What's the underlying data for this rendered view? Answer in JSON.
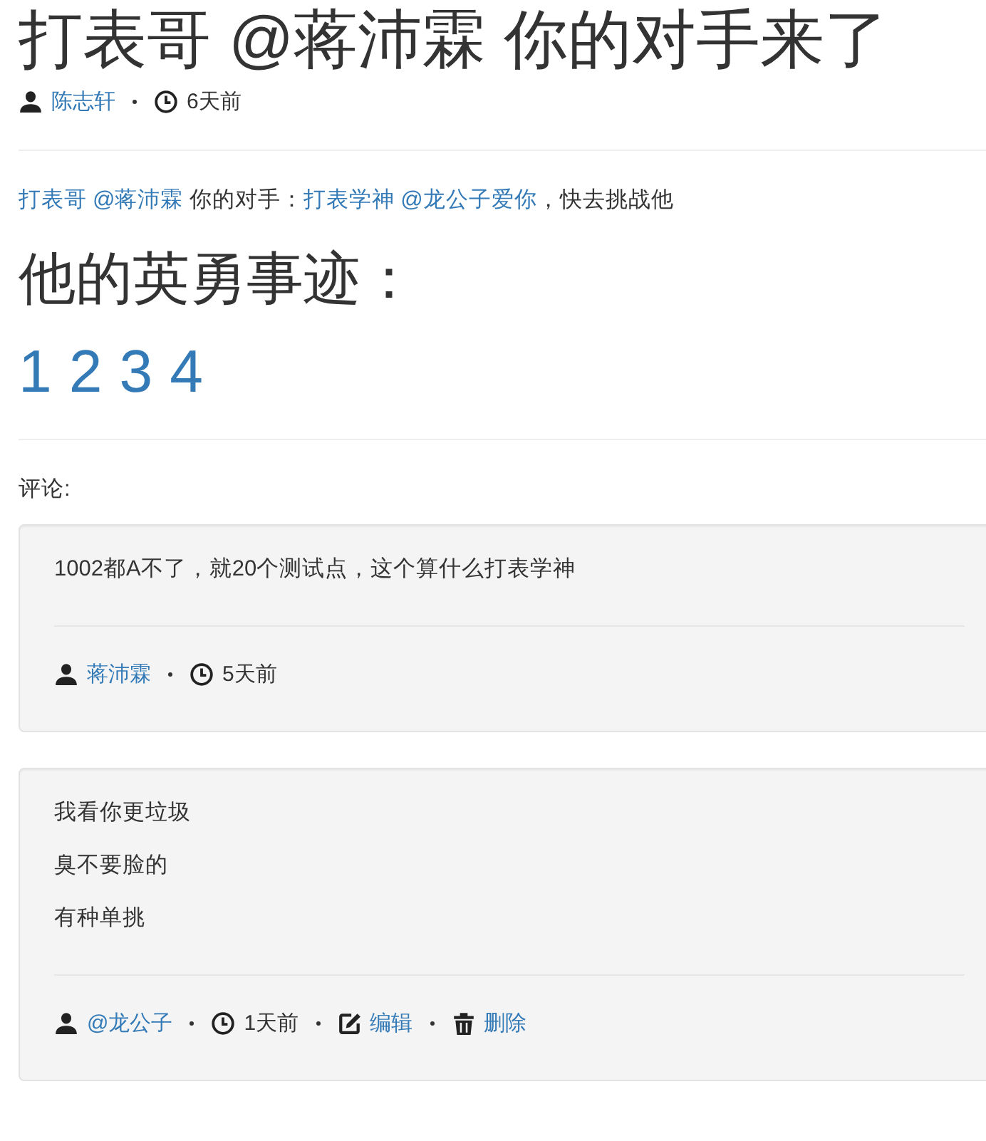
{
  "post": {
    "title": "打表哥 @蒋沛霖 你的对手来了",
    "author": "陈志轩",
    "time": "6天前",
    "body": [
      {
        "kind": "link",
        "text": "打表哥"
      },
      {
        "kind": "link",
        "text": "@蒋沛霖"
      },
      {
        "kind": "text",
        "text": " 你的对手："
      },
      {
        "kind": "link",
        "text": "打表学神"
      },
      {
        "kind": "link",
        "text": "@龙公子爱你"
      },
      {
        "kind": "text",
        "text": "，快去挑战他"
      }
    ],
    "heading": "他的英勇事迹：",
    "record_links": [
      "1",
      "2",
      "3",
      "4"
    ]
  },
  "comments_label": "评论:",
  "comments": [
    {
      "lines": [
        "1002都A不了，就20个测试点，这个算什么打表学神"
      ],
      "author": "蒋沛霖",
      "time": "5天前"
    },
    {
      "lines": [
        "我看你更垃圾",
        "臭不要脸的",
        "有种单挑"
      ],
      "author": "@龙公子",
      "time": "1天前",
      "actions": [
        {
          "kind": "edit",
          "label": "编辑"
        },
        {
          "kind": "delete",
          "label": "删除"
        }
      ]
    }
  ]
}
